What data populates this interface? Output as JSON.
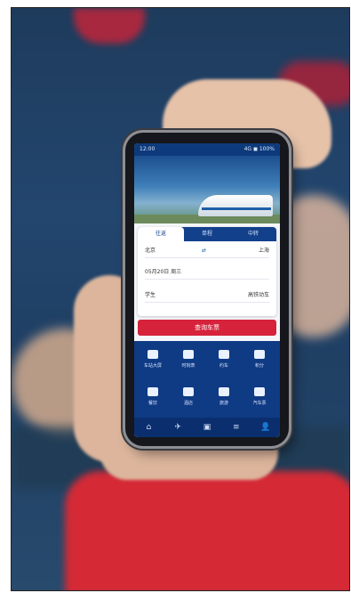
{
  "status_bar": {
    "time": "12:00",
    "right": "4G ◼ 100%"
  },
  "banner": {
    "text": ""
  },
  "form": {
    "tabs": [
      {
        "label": "往返"
      },
      {
        "label": "单程"
      },
      {
        "label": "中转"
      }
    ],
    "rows": [
      {
        "left": "北京",
        "middle": "⇄",
        "right": "上海"
      },
      {
        "left": "05月20日 周三",
        "middle": "",
        "right": ""
      },
      {
        "left": "学生",
        "middle": "",
        "right": "高铁动车"
      }
    ]
  },
  "query_button": {
    "label": "查询车票"
  },
  "services": [
    {
      "label": "车站大屏"
    },
    {
      "label": "时刻表"
    },
    {
      "label": "约车"
    },
    {
      "label": "积分"
    },
    {
      "label": "餐饮"
    },
    {
      "label": "酒店"
    },
    {
      "label": "旅游"
    },
    {
      "label": "汽车票"
    }
  ],
  "bottom_nav": [
    "⌂",
    "✈",
    "▣",
    "≡",
    "👤"
  ]
}
